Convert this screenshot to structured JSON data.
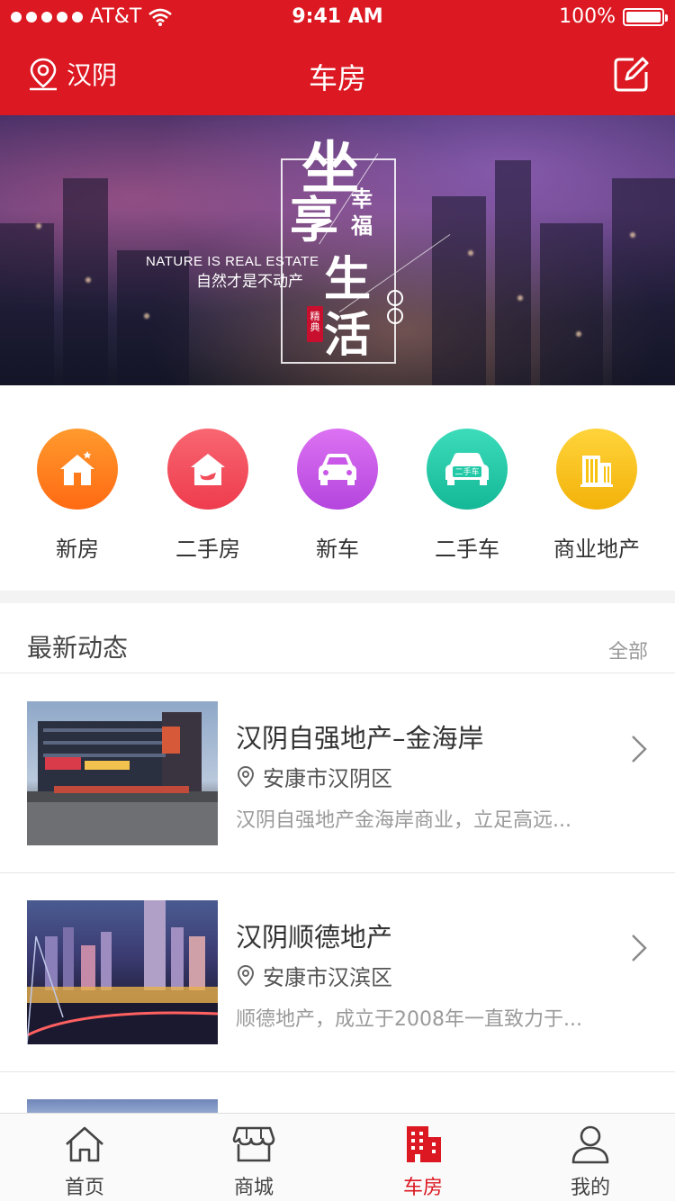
{
  "status": {
    "carrier": "AT&T",
    "time": "9:41 AM",
    "battery": "100%"
  },
  "nav": {
    "location": "汉阴",
    "title": "车房"
  },
  "banner": {
    "char1": "坐",
    "char2": "享",
    "small": "幸福",
    "char3": "生",
    "char4": "活",
    "en": "NATURE IS REAL ESTATE",
    "cn": "自然才是不动产",
    "seal": "精典"
  },
  "categories": [
    {
      "label": "新房",
      "icon": "house-star-icon",
      "color": "#ff7a1a"
    },
    {
      "label": "二手房",
      "icon": "house-hand-icon",
      "color": "#f34d5c"
    },
    {
      "label": "新车",
      "icon": "car-icon",
      "color": "#c958e8"
    },
    {
      "label": "二手车",
      "icon": "used-car-icon",
      "color": "#22c9a7",
      "badge": "二手车"
    },
    {
      "label": "商业地产",
      "icon": "building-icon",
      "color": "#f8c20f"
    }
  ],
  "section": {
    "title": "最新动态",
    "all": "全部"
  },
  "items": [
    {
      "title": "汉阴自强地产–金海岸",
      "location": "安康市汉阴区",
      "desc": "汉阴自强地产金海岸商业，立足高远..."
    },
    {
      "title": "汉阴顺德地产",
      "location": "安康市汉滨区",
      "desc": "顺德地产，成立于2008年一直致力于..."
    }
  ],
  "tabs": [
    {
      "label": "首页",
      "icon": "home-icon"
    },
    {
      "label": "商城",
      "icon": "shop-icon"
    },
    {
      "label": "车房",
      "icon": "building-icon"
    },
    {
      "label": "我的",
      "icon": "user-icon"
    }
  ],
  "colors": {
    "brand": "#dc1822"
  }
}
